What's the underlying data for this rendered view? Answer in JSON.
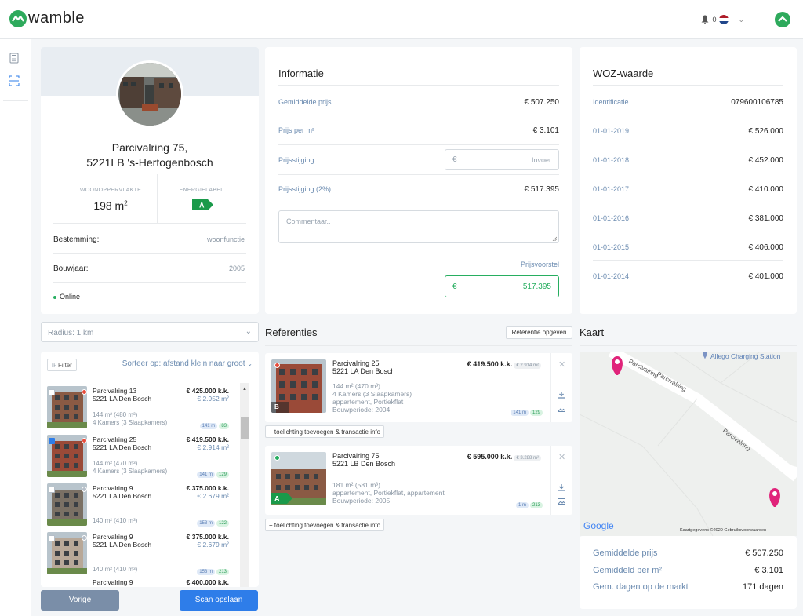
{
  "app": {
    "brand": "wamble",
    "notifications": "0"
  },
  "property": {
    "address_line1": "Parcivalring 75,",
    "address_line2": "5221LB 's-Hertogenbosch",
    "surface_label": "WOONOPPERVLAKTE",
    "surface_value": "198 m",
    "surface_sup": "2",
    "energy_label": "ENERGIELABEL",
    "energy_value": "A",
    "rows": [
      {
        "label": "Bestemming:",
        "value": "woonfunctie"
      },
      {
        "label": "Bouwjaar:",
        "value": "2005"
      }
    ],
    "status": "Online"
  },
  "informatie": {
    "title": "Informatie",
    "rows": [
      {
        "label": "Gemiddelde prijs",
        "value": "€ 507.250"
      },
      {
        "label": "Prijs per m²",
        "value": "€ 3.101"
      },
      {
        "label": "Prijsstijging",
        "currency": "€",
        "placeholder": "Invoer"
      },
      {
        "label": "Prijsstijging (2%)",
        "value": "€ 517.395"
      }
    ],
    "comment_placeholder": "Commentaar..",
    "proposal_label": "Prijsvoorstel",
    "proposal_currency": "€",
    "proposal_value": "517.395"
  },
  "woz": {
    "title": "WOZ-waarde",
    "rows": [
      {
        "label": "Identificatie",
        "value": "079600106785"
      },
      {
        "label": "01-01-2019",
        "value": "€ 526.000"
      },
      {
        "label": "01-01-2018",
        "value": "€ 452.000"
      },
      {
        "label": "01-01-2017",
        "value": "€ 410.000"
      },
      {
        "label": "01-01-2016",
        "value": "€ 381.000"
      },
      {
        "label": "01-01-2015",
        "value": "€ 406.000"
      },
      {
        "label": "01-01-2014",
        "value": "€ 401.000"
      }
    ]
  },
  "radius": {
    "label": "Radius:  1 km"
  },
  "list": {
    "filter": "Filter",
    "sort": "Sorteer op:  afstand klein naar groot",
    "items": [
      {
        "address": "Parcivalring 13",
        "city": "5221 LA Den Bosch",
        "price": "€ 425.000 k.k.",
        "ppm": "€ 2.952 m²",
        "area": "144 m² (480 m³)",
        "rooms": "4 Kamers (3 Slaapkamers)",
        "b1": "141 m",
        "b2": "83",
        "checked": false
      },
      {
        "address": "Parcivalring 25",
        "city": "5221 LA Den Bosch",
        "price": "€ 419.500 k.k.",
        "ppm": "€ 2.914 m²",
        "area": "144 m² (470 m³)",
        "rooms": "4 Kamers (3 Slaapkamers)",
        "b1": "141 m",
        "b2": "129",
        "checked": true
      },
      {
        "address": "Parcivalring 9",
        "city": "5221 LA Den Bosch",
        "price": "€ 375.000 k.k.",
        "ppm": "€ 2.679 m²",
        "area": "140 m² (410 m³)",
        "rooms": "",
        "b1": "153 m",
        "b2": "122",
        "checked": false
      },
      {
        "address": "Parcivalring 9",
        "city": "5221 LA Den Bosch",
        "price": "€ 375.000 k.k.",
        "ppm": "€ 2.679 m²",
        "area": "140 m² (410 m³)",
        "rooms": "",
        "b1": "153 m",
        "b2": "213",
        "checked": false
      }
    ],
    "partial": "Parcivalring 9",
    "partial_price": "€ 400.000 k.k."
  },
  "buttons": {
    "prev": "Vorige",
    "save": "Scan opslaan"
  },
  "referenties": {
    "title": "Referenties",
    "action": "Referentie opgeven",
    "link": "+ toelichting toevoegen & transactie info",
    "cards": [
      {
        "address": "Parcivalring 25",
        "city": "5221 LA Den Bosch",
        "price": "€ 419.500 k.k.",
        "ppm": "€ 2.914 m²",
        "area": "144 m² (470 m³)",
        "rooms": "4 Kamers (3 Slaapkamers)",
        "type": "appartement, Portiekflat",
        "period": "Bouwperiode: 2004",
        "b1": "141 m",
        "b2": "129",
        "energy": "B"
      },
      {
        "address": "Parcivalring 75",
        "city": "5221 LB Den Bosch",
        "price": "€ 595.000 k.k.",
        "ppm": "€ 3.288 m²",
        "area": "181 m² (581 m³)",
        "type": "appartement, Portiekflat, appartement",
        "period": "Bouwperiode: 2005",
        "b1": "1 m",
        "b2": "213",
        "energy": "A"
      }
    ]
  },
  "kaart": {
    "title": "Kaart",
    "poi": "Allego Charging Station",
    "street": "Parcivalring",
    "google": "Google",
    "credits": "Kaartgegevens ©2020   Gebruiksvoorwaarden",
    "summary": [
      {
        "label": "Gemiddelde prijs",
        "value": "€ 507.250"
      },
      {
        "label": "Gemiddeld per m²",
        "value": "€ 3.101"
      },
      {
        "label": "Gem. dagen op de markt",
        "value": "171 dagen"
      }
    ]
  },
  "colors": {
    "brand": "#2eaa5c",
    "primary": "#2e7de9",
    "secondary": "#7a8ea8",
    "pin": "#e0237a",
    "energyA": "#1a9a4a"
  }
}
